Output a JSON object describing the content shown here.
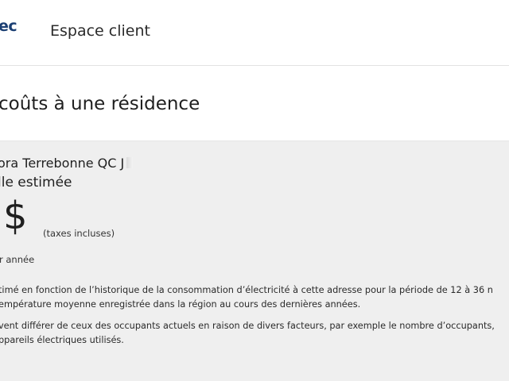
{
  "header": {
    "logo_text": "ec",
    "title": "Espace client"
  },
  "page": {
    "title": "coûts à une résidence"
  },
  "estimate": {
    "address": "ora Terrebonne QC J",
    "bill_label": "lle estimée",
    "amount_symbol": "$",
    "taxes_note": "(taxes incluses)",
    "period": "r année"
  },
  "info": {
    "para1_line1": "timé en fonction de l’historique de la consommation d’électricité à cette adresse pour la période de 12 à 36 n",
    "para1_line2": "empérature moyenne enregistrée dans la région au cours des dernières années.",
    "para2_line1": "vent différer de ceux des occupants actuels en raison de divers facteurs, par exemple le nombre d’occupants,",
    "para2_line2": "ppareils électriques utilisés."
  }
}
